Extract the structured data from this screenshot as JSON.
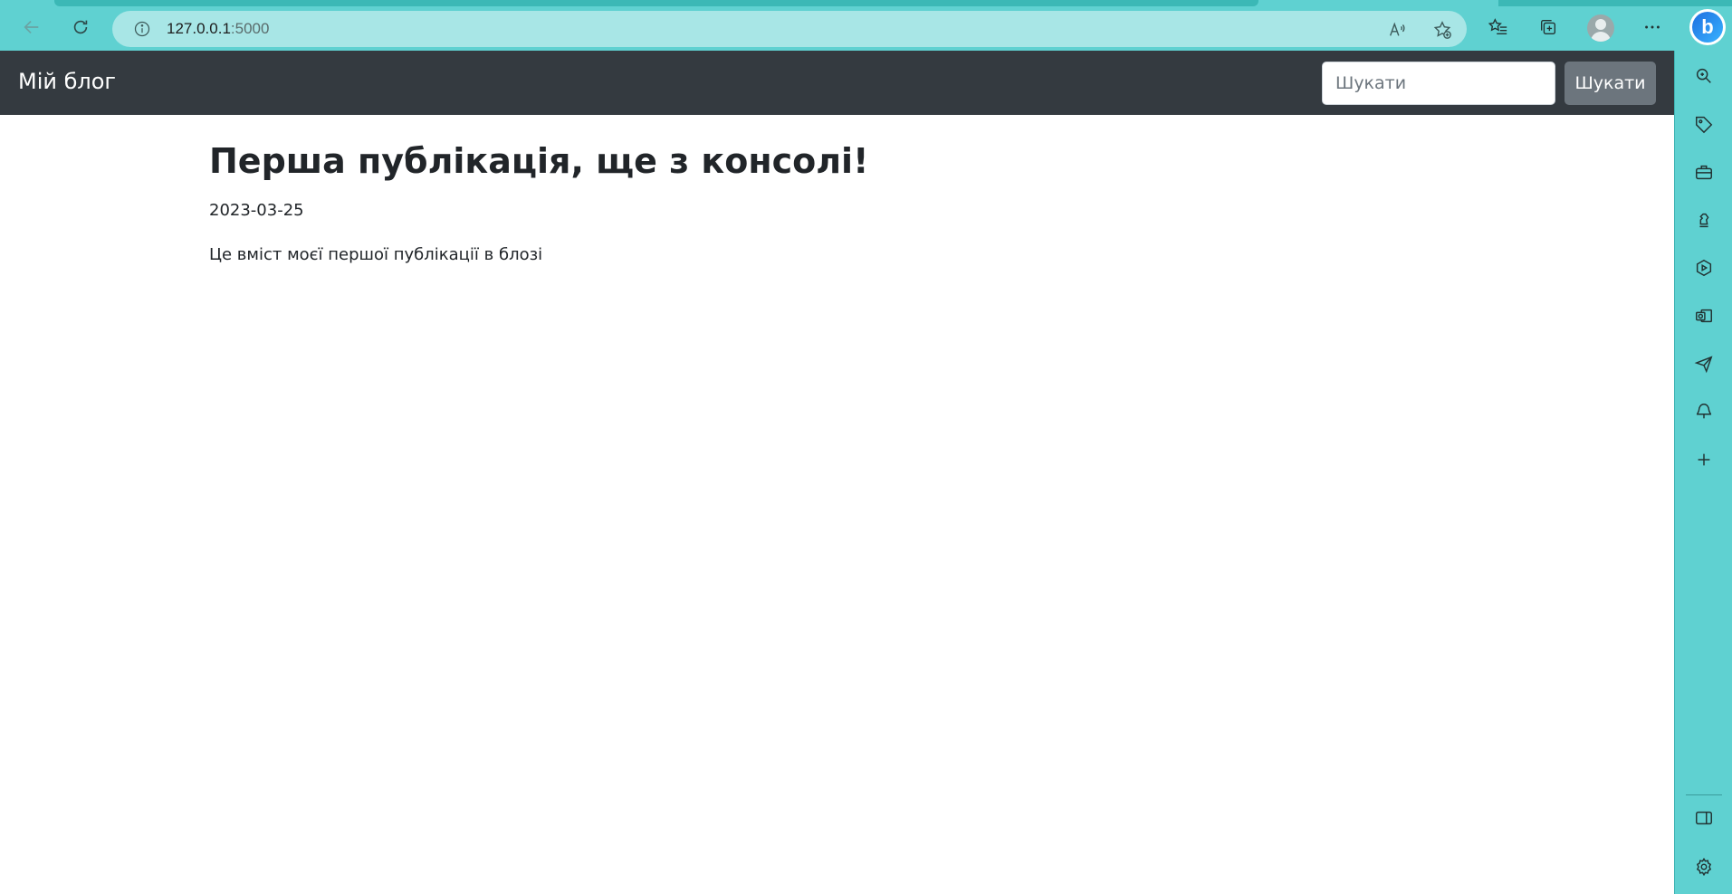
{
  "browser": {
    "address": {
      "host": "127.0.0.1",
      "port": ":5000"
    },
    "icons": {
      "back": "back-arrow-icon",
      "refresh": "refresh-icon",
      "info": "info-icon",
      "read_aloud": "read-aloud-icon",
      "add_favorite": "add-favorite-icon",
      "favorites": "favorites-icon",
      "collections": "collections-icon",
      "profile": "profile-avatar",
      "more": "more-icon",
      "bing": "bing-copilot-icon"
    },
    "bing_letter": "b"
  },
  "navbar": {
    "brand": "Мій блог",
    "search_placeholder": "Шукати",
    "search_button": "Шукати"
  },
  "post": {
    "title": "Перша публікація, ще з консолі!",
    "date": "2023-03-25",
    "content": "Це вміст моєї першої публікації в блозі"
  },
  "sidebar": {
    "items": [
      "search-icon",
      "tag-icon",
      "toolbox-icon",
      "chess-icon",
      "play-icon",
      "outlook-icon",
      "send-icon",
      "tree-icon",
      "add-icon"
    ],
    "bottom": [
      "panel-icon",
      "settings-icon"
    ]
  },
  "colors": {
    "chrome": "#5fd1d1",
    "navbar": "#343a40",
    "button": "#6c757d"
  }
}
